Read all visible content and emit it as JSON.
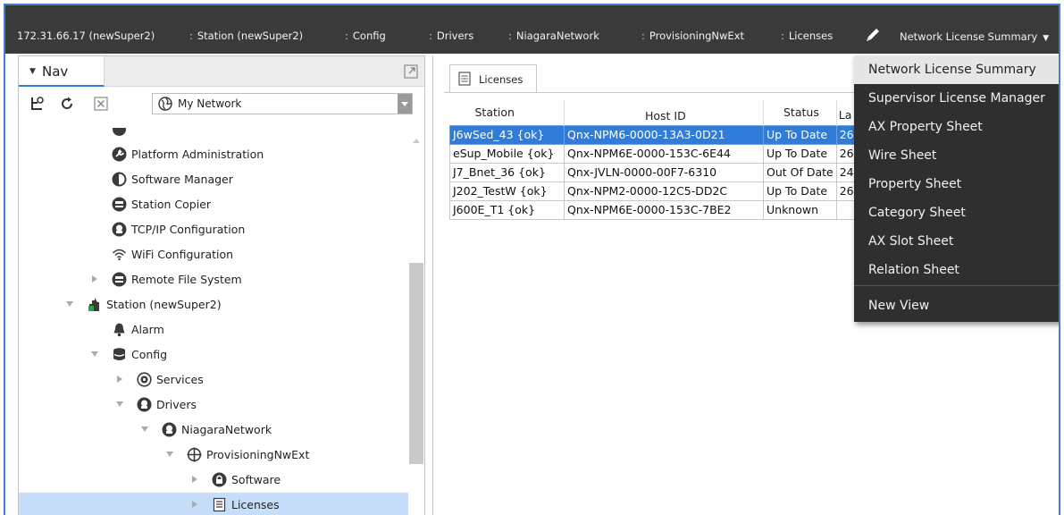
{
  "breadcrumb": [
    {
      "label": "172.31.66.17 (newSuper2)",
      "sep": ""
    },
    {
      "label": "Station (newSuper2)",
      "sep": ":"
    },
    {
      "label": "Config",
      "sep": ":"
    },
    {
      "label": "Drivers",
      "sep": ":"
    },
    {
      "label": "NiagaraNetwork",
      "sep": ":"
    },
    {
      "label": "ProvisioningNwExt",
      "sep": ":"
    },
    {
      "label": "Licenses",
      "sep": ":"
    }
  ],
  "view_selector": {
    "label": "Network License Summary"
  },
  "nav": {
    "title": "Nav",
    "network_select": "My Network",
    "tree": [
      {
        "label": "Platform Administration",
        "icon": "gear-icon"
      },
      {
        "label": "Software Manager",
        "icon": "software-icon"
      },
      {
        "label": "Station Copier",
        "icon": "copier-icon"
      },
      {
        "label": "TCP/IP Configuration",
        "icon": "network-config-icon"
      },
      {
        "label": "WiFi Configuration",
        "icon": "wifi-icon"
      },
      {
        "label": "Remote File System",
        "icon": "file-system-icon"
      },
      {
        "label": "Station (newSuper2)",
        "icon": "station-icon"
      },
      {
        "label": "Alarm",
        "icon": "bell-icon"
      },
      {
        "label": "Config",
        "icon": "database-icon"
      },
      {
        "label": "Services",
        "icon": "services-icon"
      },
      {
        "label": "Drivers",
        "icon": "drivers-icon"
      },
      {
        "label": "NiagaraNetwork",
        "icon": "niagara-network-icon"
      },
      {
        "label": "ProvisioningNwExt",
        "icon": "provisioning-icon"
      },
      {
        "label": "Software",
        "icon": "software-lock-icon"
      },
      {
        "label": "Licenses",
        "icon": "document-icon"
      }
    ]
  },
  "main": {
    "tab_label": "Licenses",
    "columns": [
      "Station",
      "Host ID",
      "Status",
      "La"
    ],
    "rows": [
      {
        "station": "J6wSed_43 {ok}",
        "host": "Qnx-NPM6-0000-13A3-0D21",
        "status": "Up To Date",
        "last": "26"
      },
      {
        "station": "eSup_Mobile {ok}",
        "host": "Qnx-NPM6E-0000-153C-6E44",
        "status": "Up To Date",
        "last": "26"
      },
      {
        "station": "J7_Bnet_36 {ok}",
        "host": "Qnx-JVLN-0000-00F7-6310",
        "status": "Out Of Date",
        "last": "24"
      },
      {
        "station": "J202_TestW {ok}",
        "host": "Qnx-NPM2-0000-12C5-DD2C",
        "status": "Up To Date",
        "last": "26"
      },
      {
        "station": "J600E_T1 {ok}",
        "host": "Qnx-NPM6E-0000-153C-7BE2",
        "status": "Unknown",
        "last": ""
      }
    ]
  },
  "menu": {
    "items": [
      "Network License Summary",
      "Supervisor License Manager",
      "AX Property Sheet",
      "Wire Sheet",
      "Property Sheet",
      "Category Sheet",
      "AX Slot Sheet",
      "Relation Sheet"
    ],
    "extra": "New View"
  },
  "colors": {
    "accent": "#2f7dd8",
    "breadcrumb_bg": "#3a3a3a",
    "menu_bg": "#2f2f2f",
    "selection": "#c7defa"
  }
}
